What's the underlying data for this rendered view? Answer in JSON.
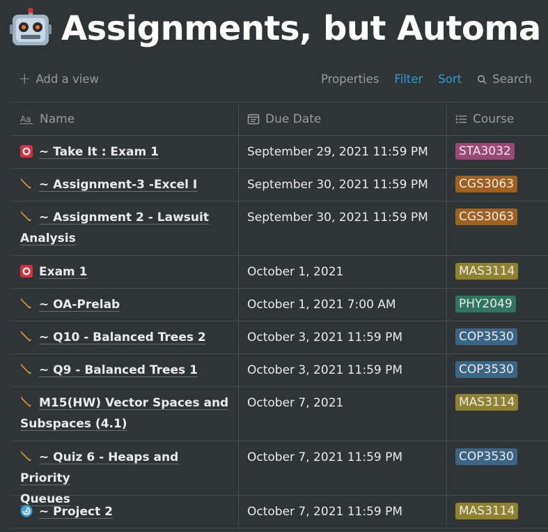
{
  "page": {
    "title": "Assignments, but Automa",
    "icon": "robot-icon"
  },
  "toolbar": {
    "add_view": "Add a view",
    "properties": "Properties",
    "filter": "Filter",
    "sort": "Sort",
    "search": "Search"
  },
  "columns": {
    "name": "Name",
    "due_date": "Due Date",
    "course": "Course"
  },
  "colors": {
    "STA3032": "#9c4874",
    "CGS3063": "#a0601f",
    "MAS3114": "#8e8230",
    "PHY2049": "#2f7560",
    "COP3530": "#3b6585"
  },
  "rows": [
    {
      "icon": "o-button-icon",
      "name": "~ Take It : Exam 1",
      "due": "September 29, 2021 11:59 PM",
      "course": "STA3032"
    },
    {
      "icon": "pencil-icon",
      "name": "~ Assignment-3 -Excel I",
      "due": "September 30, 2021 11:59 PM",
      "course": "CGS3063"
    },
    {
      "icon": "pencil-icon",
      "name_line1": "~ Assignment 2 - Lawsuit",
      "name_line2": "Analysis",
      "due": "September 30, 2021 11:59 PM",
      "course": "CGS3063"
    },
    {
      "icon": "o-button-icon",
      "name": "Exam 1",
      "due": "October 1, 2021",
      "course": "MAS3114"
    },
    {
      "icon": "pencil-icon",
      "name": "~ OA-Prelab",
      "due": "October 1, 2021 7:00 AM",
      "course": "PHY2049"
    },
    {
      "icon": "pencil-icon",
      "name": "~ Q10 - Balanced Trees 2",
      "due": "October 3, 2021 11:59 PM",
      "course": "COP3530"
    },
    {
      "icon": "pencil-icon",
      "name": "~ Q9 - Balanced Trees 1",
      "due": "October 3, 2021 11:59 PM",
      "course": "COP3530"
    },
    {
      "icon": "pencil-icon",
      "name_line1": "M15(HW) Vector Spaces and",
      "name_line2": "Subspaces (4.1)",
      "due": "October 7, 2021",
      "course": "MAS3114"
    },
    {
      "icon": "pencil-icon",
      "name_line1": "~ Quiz 6 - Heaps and Priority",
      "name_line2": "Queues",
      "due": "October 7, 2021 11:59 PM",
      "course": "COP3530"
    },
    {
      "icon": "cyclone-icon",
      "name": "~ Project 2",
      "due": "October 7, 2021 11:59 PM",
      "course": "MAS3114"
    }
  ]
}
